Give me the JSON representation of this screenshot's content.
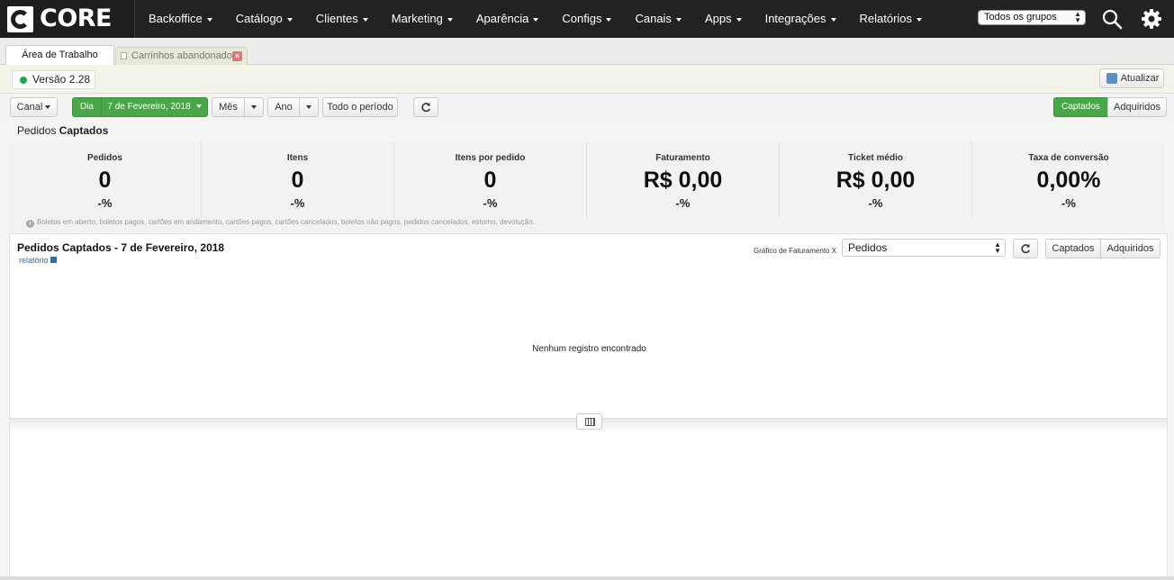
{
  "header": {
    "logo_text": "CORE",
    "nav": [
      {
        "label": "Backoffice"
      },
      {
        "label": "Catálogo"
      },
      {
        "label": "Clientes"
      },
      {
        "label": "Marketing"
      },
      {
        "label": "Aparência"
      },
      {
        "label": "Configs"
      },
      {
        "label": "Canais"
      },
      {
        "label": "Apps"
      },
      {
        "label": "Integrações"
      },
      {
        "label": "Relatórios"
      }
    ],
    "group_select": "Todos os grupos",
    "search_icon": "search-icon",
    "settings_icon": "gear-icon"
  },
  "tabs": {
    "active": "Área de Trabalho",
    "inactive": "Carrinhos abandonados"
  },
  "version": {
    "label": "Versão 2.28",
    "status_color": "#28a745"
  },
  "refresh_button": "Atualizar",
  "filters": {
    "canal": "Canal",
    "dia": "Dia",
    "date": "7 de Fevereiro, 2018",
    "mes": "Mês",
    "ano": "Ano",
    "todo": "Todo o período",
    "captados": "Captados",
    "adquiridos": "Adquiridos"
  },
  "summary": {
    "title_prefix": "Pedidos",
    "title_bold": "Captados",
    "stats": [
      {
        "label": "Pedidos",
        "value": "0",
        "pct": "-%"
      },
      {
        "label": "Itens",
        "value": "0",
        "pct": "-%"
      },
      {
        "label": "Itens por pedido",
        "value": "0",
        "pct": "-%"
      },
      {
        "label": "Faturamento",
        "value": "R$ 0,00",
        "pct": "-%"
      },
      {
        "label": "Ticket médio",
        "value": "R$ 0,00",
        "pct": "-%"
      },
      {
        "label": "Taxa de conversão",
        "value": "0,00%",
        "pct": "-%"
      }
    ],
    "note": "Boletos em aberto, boletos pagos, cartões em andamento, cartões pagos, cartões cancelados, boletos não pagos, pedidos cancelados, estorno, devolução."
  },
  "chart_panel": {
    "title": "Pedidos Captados - 7 de Fevereiro, 2018",
    "link": "relatório",
    "chart_label": "Gráfico de Faturamento X",
    "chart_select": "Pedidos",
    "captados": "Captados",
    "adquiridos": "Adquiridos",
    "empty_message": "Nenhum registro encontrado"
  },
  "colors": {
    "topbar": "#222222",
    "accent_green": "#48a848",
    "link_blue": "#2a6fb0"
  }
}
